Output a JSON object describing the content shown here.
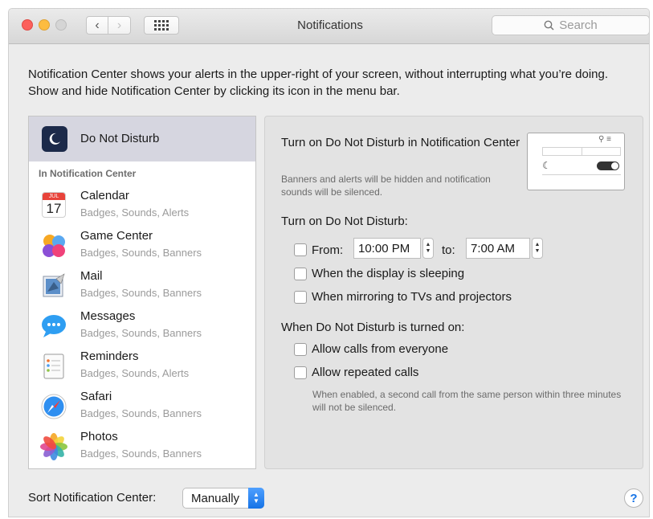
{
  "window": {
    "title": "Notifications",
    "search_placeholder": "Search"
  },
  "intro": "Notification Center shows your alerts in the upper-right of your screen, without interrupting what you’re doing. Show and hide Notification Center by clicking its icon in the menu bar.",
  "sidebar": {
    "dnd_label": "Do Not Disturb",
    "section_header": "In Notification Center",
    "apps": [
      {
        "name": "Calendar",
        "sub": "Badges, Sounds, Alerts",
        "icon": "calendar-icon"
      },
      {
        "name": "Game Center",
        "sub": "Badges, Sounds, Banners",
        "icon": "game-center-icon"
      },
      {
        "name": "Mail",
        "sub": "Badges, Sounds, Banners",
        "icon": "mail-icon"
      },
      {
        "name": "Messages",
        "sub": "Badges, Sounds, Banners",
        "icon": "messages-icon"
      },
      {
        "name": "Reminders",
        "sub": "Badges, Sounds, Alerts",
        "icon": "reminders-icon"
      },
      {
        "name": "Safari",
        "sub": "Badges, Sounds, Banners",
        "icon": "safari-icon"
      },
      {
        "name": "Photos",
        "sub": "Badges, Sounds, Banners",
        "icon": "photos-icon"
      }
    ],
    "calendar_month": "JUL",
    "calendar_day": "17"
  },
  "panel": {
    "heading": "Turn on Do Not Disturb in Notification Center",
    "heading_note": "Banners and alerts will be hidden and notification sounds will be silenced.",
    "turn_on_heading": "Turn on Do Not Disturb:",
    "from_label": "From:",
    "from_time": "10:00 PM",
    "to_label": "to:",
    "to_time": "7:00 AM",
    "display_sleeping": "When the display is sleeping",
    "mirroring": "When mirroring to TVs and projectors",
    "when_on_heading": "When Do Not Disturb is turned on:",
    "allow_calls": "Allow calls from everyone",
    "allow_repeated": "Allow repeated calls",
    "repeated_note": "When enabled, a second call from the same person within three minutes will not be silenced."
  },
  "footer": {
    "sort_label": "Sort Notification Center:",
    "sort_value": "Manually",
    "help": "?"
  },
  "colors": {
    "accent": "#1673e6",
    "selected_row": "#d6d6e0"
  }
}
